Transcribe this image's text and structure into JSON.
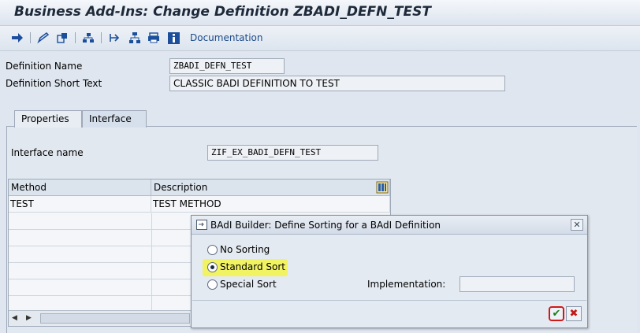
{
  "window": {
    "title": "Business Add-Ins: Change Definition ZBADI_DEFN_TEST"
  },
  "toolbar": {
    "icons": [
      "arrow-right-icon",
      "edit-icon",
      "copy-object-icon",
      "hierarchy-icon",
      "navigate-icon",
      "tree-icon",
      "print-icon",
      "info-icon"
    ],
    "documentation_label": "Documentation"
  },
  "definition": {
    "name_label": "Definition Name",
    "name_value": "ZBADI_DEFN_TEST",
    "short_text_label": "Definition Short Text",
    "short_text_value": "CLASSIC BADI DEFINITION TO TEST"
  },
  "tabs": [
    {
      "label": "Properties",
      "active": false
    },
    {
      "label": "Interface",
      "active": true
    }
  ],
  "interface": {
    "name_label": "Interface name",
    "name_value": "ZIF_EX_BADI_DEFN_TEST"
  },
  "methods_table": {
    "columns": [
      "Method",
      "Description"
    ],
    "rows": [
      {
        "method": "TEST",
        "description": "TEST METHOD"
      }
    ]
  },
  "dialog": {
    "title": "BAdI Builder: Define Sorting for a BAdI Definition",
    "options": [
      {
        "label": "No Sorting",
        "checked": false
      },
      {
        "label": "Standard Sort",
        "checked": true
      },
      {
        "label": "Special Sort",
        "checked": false
      }
    ],
    "implementation_label": "Implementation:",
    "implementation_value": "",
    "highlight_color": "#f5f54a"
  }
}
